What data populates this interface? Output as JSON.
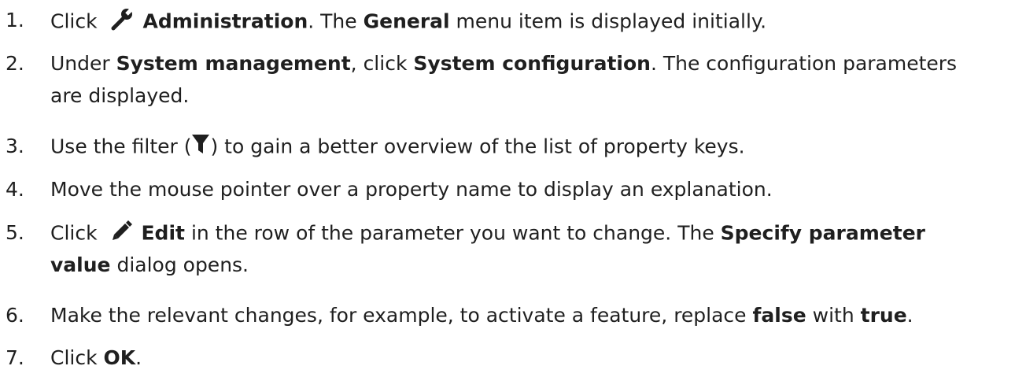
{
  "steps": [
    {
      "num": "1.",
      "parts": {
        "a": "Click",
        "b": "Administration",
        "c": ". The",
        "d": "General",
        "e": "menu item is displayed initially."
      },
      "icon": "wrench-icon"
    },
    {
      "num": "2.",
      "parts": {
        "a": "Under",
        "b": "System management",
        "c": ", click",
        "d": "System configuration",
        "e": ". The configuration parameters",
        "f": "are displayed."
      }
    },
    {
      "num": "3.",
      "parts": {
        "a": "Use the filter (",
        "c": ") to gain a better overview of the list of property keys."
      },
      "icon": "filter-icon"
    },
    {
      "num": "4.",
      "parts": {
        "a": "Move the mouse pointer over a property name to display an explanation."
      }
    },
    {
      "num": "5.",
      "parts": {
        "a": "Click",
        "b": "Edit",
        "c": "in the row of the parameter you want to change. The",
        "d": "Specify parameter",
        "e": "value",
        "f": "dialog opens."
      },
      "icon": "pencil-icon"
    },
    {
      "num": "6.",
      "parts": {
        "a": "Make the relevant changes, for example, to activate a feature, replace",
        "b": "false",
        "c": "with",
        "d": "true",
        "e": "."
      }
    },
    {
      "num": "7.",
      "parts": {
        "a": "Click",
        "b": "OK",
        "c": "."
      }
    }
  ]
}
